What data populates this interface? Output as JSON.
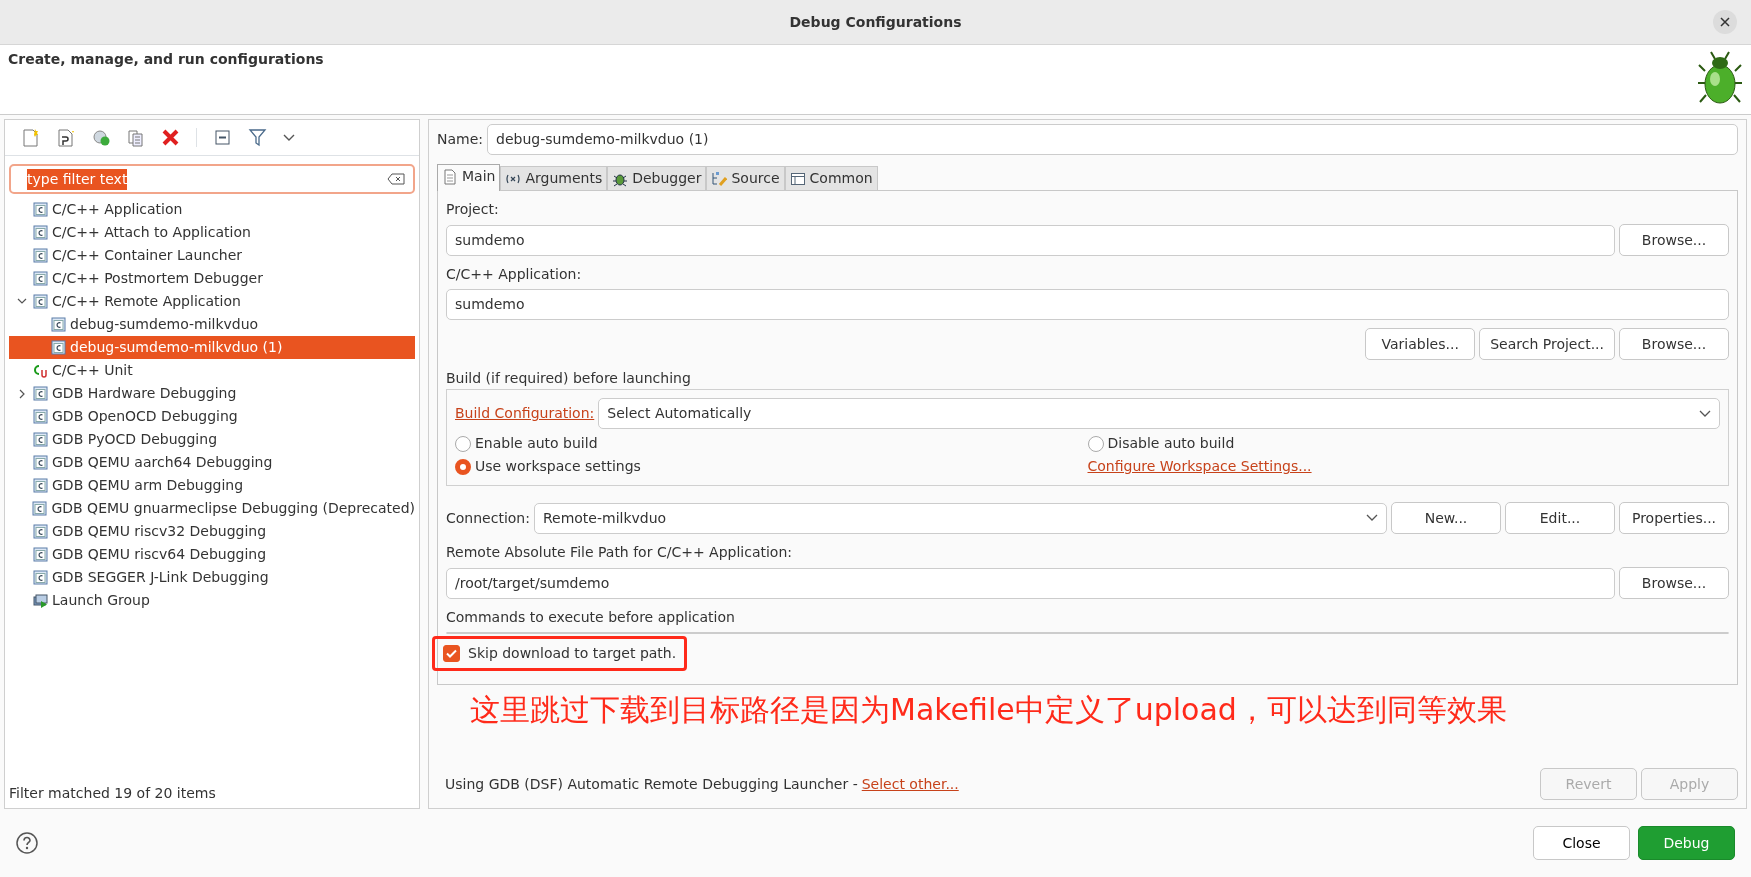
{
  "window": {
    "title": "Debug Configurations"
  },
  "header": {
    "title": "Create, manage, and run configurations"
  },
  "left_panel": {
    "filter": {
      "value": "type filter text"
    },
    "tree": [
      {
        "label": "C/C++ Application",
        "kind": "config",
        "selected": false
      },
      {
        "label": "C/C++ Attach to Application",
        "kind": "config",
        "selected": false
      },
      {
        "label": "C/C++ Container Launcher",
        "kind": "config",
        "selected": false
      },
      {
        "label": "C/C++ Postmortem Debugger",
        "kind": "config",
        "selected": false
      },
      {
        "label": "C/C++ Remote Application",
        "kind": "config",
        "selected": false,
        "expanded": true,
        "children": [
          {
            "label": "debug-sumdemo-milkvduo",
            "kind": "config",
            "selected": false
          },
          {
            "label": "debug-sumdemo-milkvduo (1)",
            "kind": "config",
            "selected": true
          }
        ]
      },
      {
        "label": "C/C++ Unit",
        "kind": "unit",
        "selected": false
      },
      {
        "label": "GDB Hardware Debugging",
        "kind": "config",
        "selected": false,
        "expanded": false
      },
      {
        "label": "GDB OpenOCD Debugging",
        "kind": "config",
        "selected": false
      },
      {
        "label": "GDB PyOCD Debugging",
        "kind": "config",
        "selected": false
      },
      {
        "label": "GDB QEMU aarch64 Debugging",
        "kind": "config",
        "selected": false
      },
      {
        "label": "GDB QEMU arm Debugging",
        "kind": "config",
        "selected": false
      },
      {
        "label": "GDB QEMU gnuarmeclipse Debugging (Deprecated)",
        "kind": "config",
        "selected": false
      },
      {
        "label": "GDB QEMU riscv32 Debugging",
        "kind": "config",
        "selected": false
      },
      {
        "label": "GDB QEMU riscv64 Debugging",
        "kind": "config",
        "selected": false
      },
      {
        "label": "GDB SEGGER J-Link Debugging",
        "kind": "config",
        "selected": false
      },
      {
        "label": "Launch Group",
        "kind": "group",
        "selected": false
      }
    ],
    "status": "Filter matched 19 of 20 items"
  },
  "editor": {
    "name_label": "Name:",
    "name_value": "debug-sumdemo-milkvduo (1)",
    "tabs": [
      {
        "label": "Main",
        "selected": true
      },
      {
        "label": "Arguments",
        "selected": false
      },
      {
        "label": "Debugger",
        "selected": false
      },
      {
        "label": "Source",
        "selected": false
      },
      {
        "label": "Common",
        "selected": false
      }
    ],
    "project": {
      "label": "Project:",
      "value": "sumdemo",
      "button": "Browse..."
    },
    "application": {
      "label": "C/C++ Application:",
      "value": "sumdemo",
      "buttons": [
        "Variables...",
        "Search Project...",
        "Browse..."
      ]
    },
    "build": {
      "legend": "Build (if required) before launching",
      "config_link": "Build Configuration:",
      "config_value": "Select Automatically",
      "options": [
        {
          "label": "Enable auto build",
          "selected": false
        },
        {
          "label": "Disable auto build",
          "selected": false
        },
        {
          "label": "Use workspace settings",
          "selected": true
        }
      ],
      "workspace_link": "Configure Workspace Settings..."
    },
    "connection": {
      "label": "Connection:",
      "value": "Remote-milkvduo",
      "buttons": [
        "New...",
        "Edit...",
        "Properties..."
      ]
    },
    "remote_path": {
      "label": "Remote Absolute File Path for C/C++ Application:",
      "value": "/root/target/sumdemo",
      "button": "Browse..."
    },
    "commands": {
      "label": "Commands to execute before application"
    },
    "skip_download": {
      "label": "Skip download to target path.",
      "checked": true
    },
    "annotation": "这里跳过下载到目标路径是因为Makefile中定义了upload，可以达到同等效果",
    "launcher": {
      "text": "Using GDB (DSF) Automatic Remote Debugging Launcher -",
      "link": "Select other..."
    },
    "actions": [
      {
        "label": "Revert",
        "disabled": true
      },
      {
        "label": "Apply",
        "disabled": true
      }
    ]
  },
  "footer": {
    "buttons": [
      {
        "label": "Close",
        "kind": "default"
      },
      {
        "label": "Debug",
        "kind": "primary"
      }
    ]
  }
}
